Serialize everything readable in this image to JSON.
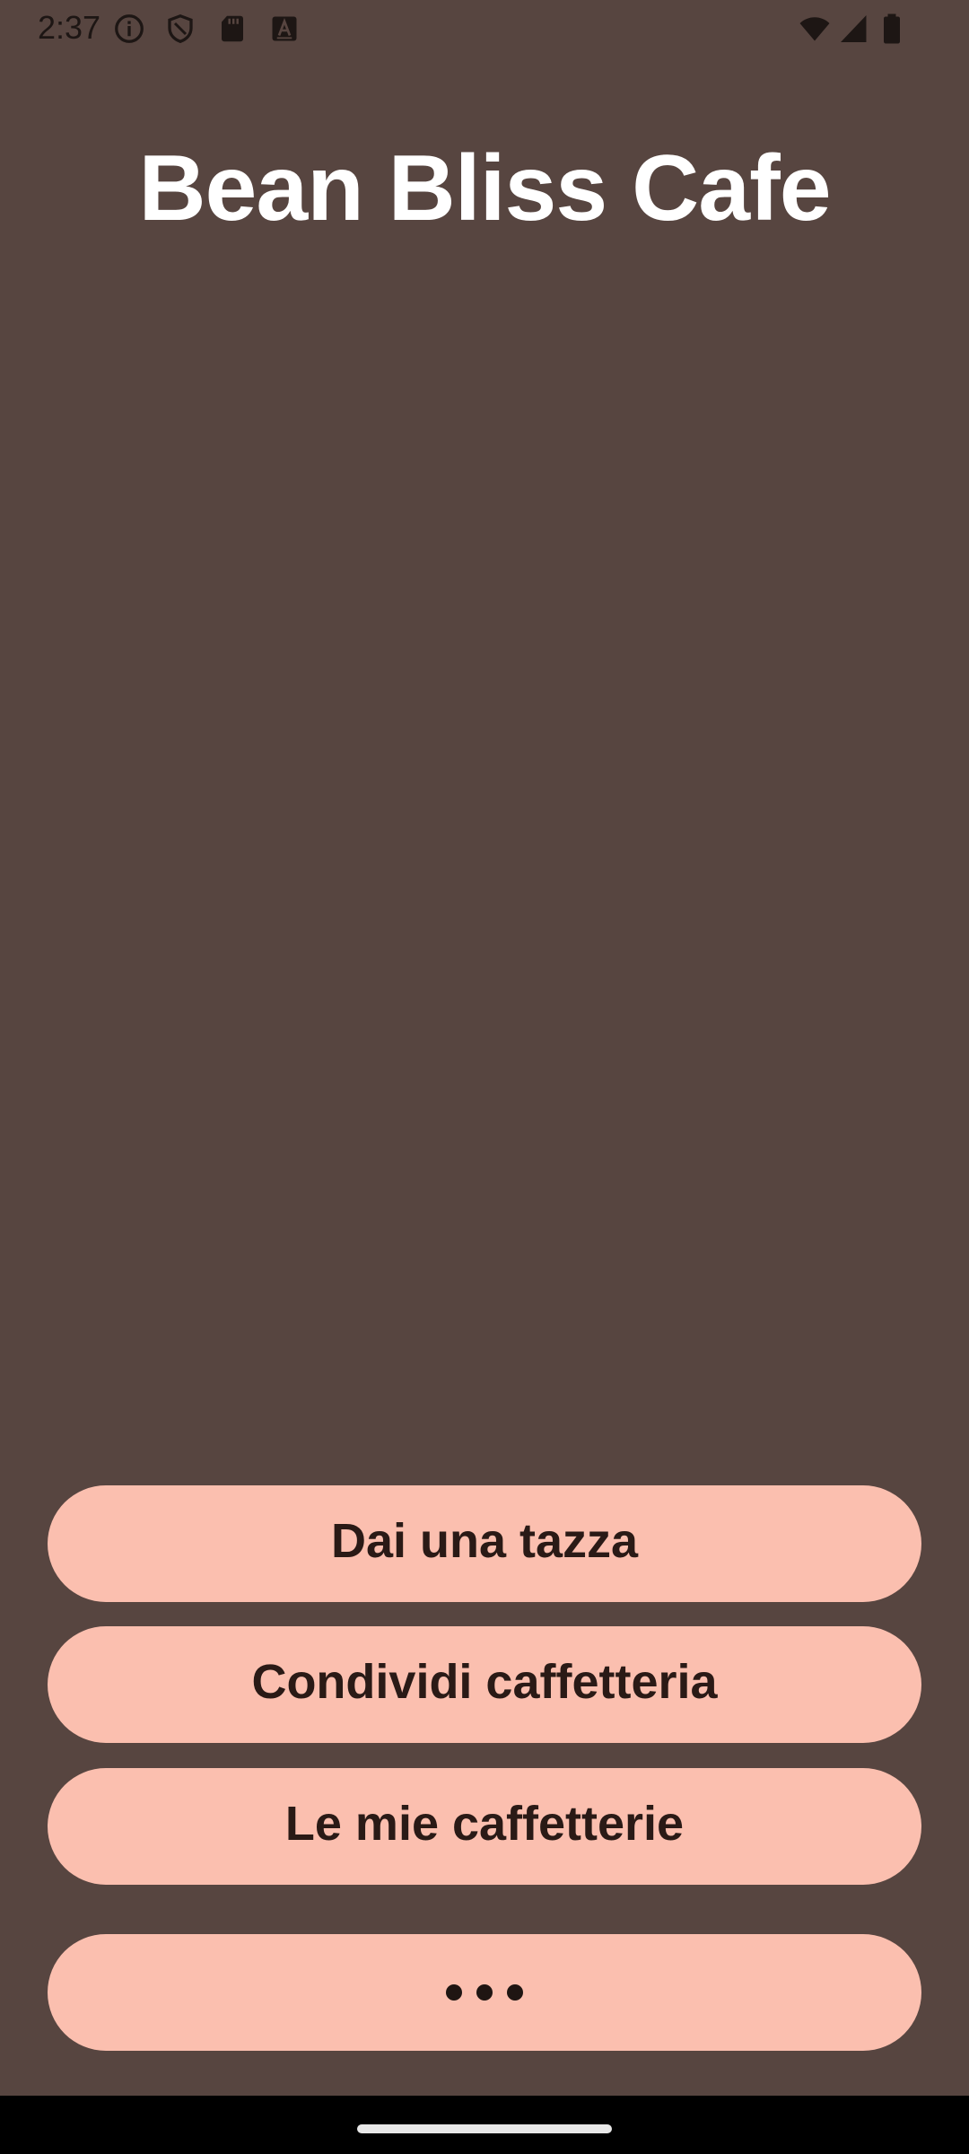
{
  "status_bar": {
    "time": "2:37",
    "left_icons": [
      "info-icon",
      "shield-icon",
      "sd-card-icon",
      "keyboard-a-icon"
    ],
    "right_icons": [
      "wifi-icon",
      "signal-icon",
      "battery-icon"
    ]
  },
  "app": {
    "title": "Bean Bliss Cafe"
  },
  "actions": {
    "give_cup": "Dai una tazza",
    "share_cafe": "Condividi caffetteria",
    "my_cafes": "Le mie caffetterie",
    "more_icon": "more-horizontal-icon"
  },
  "colors": {
    "background": "#574540",
    "button": "#fbbfaf",
    "button_text": "#2a1a16",
    "title": "#ffffff"
  }
}
